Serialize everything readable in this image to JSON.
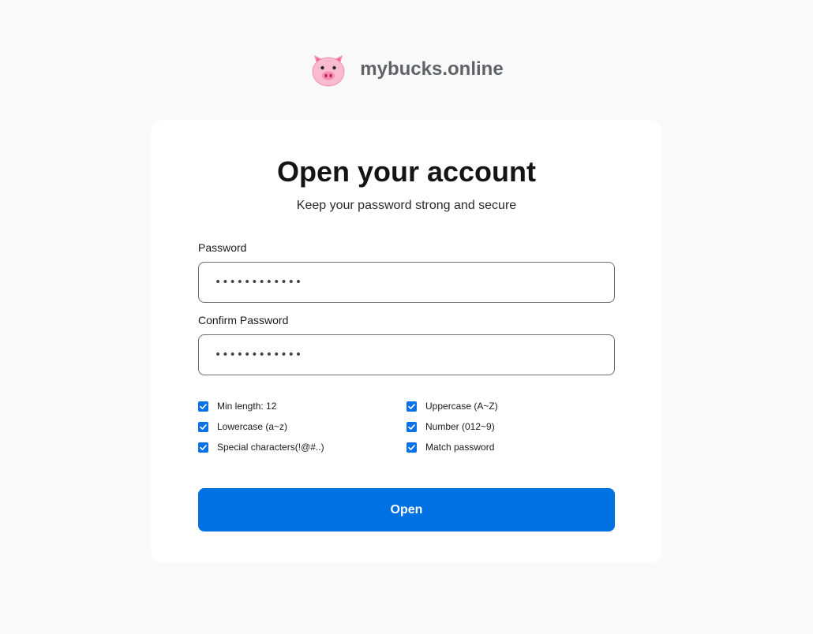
{
  "brand": {
    "name": "mybucks.online",
    "logo_icon": "pig-face-icon"
  },
  "card": {
    "title": "Open your account",
    "subtitle": "Keep your password strong and secure"
  },
  "form": {
    "password_label": "Password",
    "password_value": "••••••••••••",
    "confirm_label": "Confirm Password",
    "confirm_value": "••••••••••••"
  },
  "requirements": [
    {
      "label": "Min length: 12",
      "checked": true
    },
    {
      "label": "Uppercase (A~Z)",
      "checked": true
    },
    {
      "label": "Lowercase (a~z)",
      "checked": true
    },
    {
      "label": "Number (012~9)",
      "checked": true
    },
    {
      "label": "Special characters(!@#..)",
      "checked": true
    },
    {
      "label": "Match password",
      "checked": true
    }
  ],
  "submit": {
    "label": "Open"
  },
  "colors": {
    "accent": "#0071e3",
    "checkbox": "#0a72e6",
    "background": "#f9f9f9",
    "card": "#ffffff"
  }
}
